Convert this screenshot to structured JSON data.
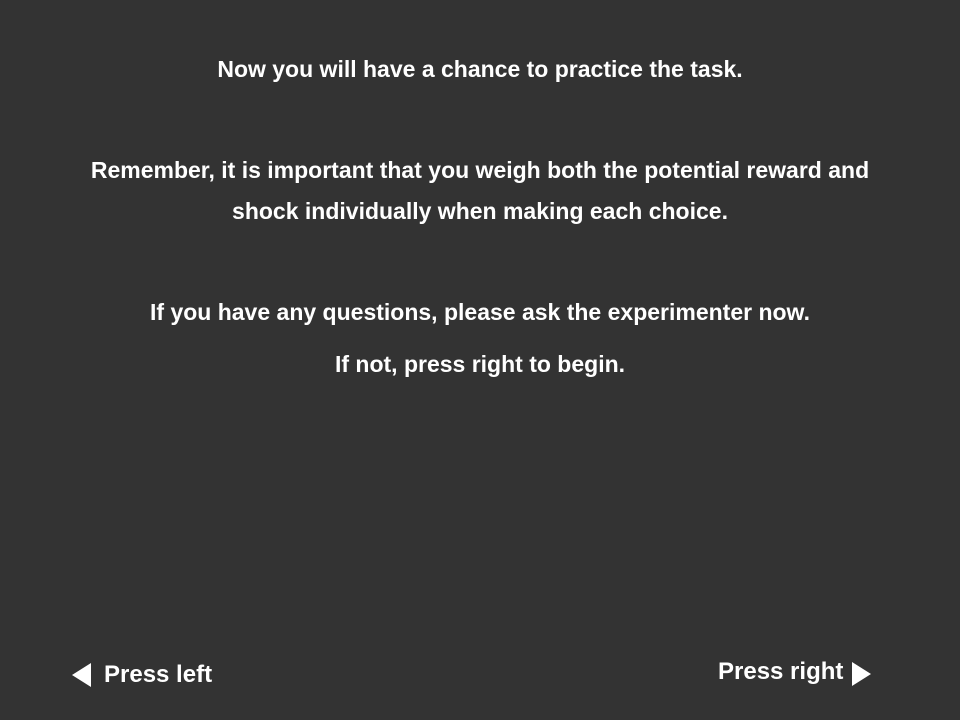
{
  "instructions": {
    "line1": "Now you will have a chance to practice the task.",
    "line2": "Remember, it is important that you weigh both the potential reward and",
    "line3": "shock individually when making each choice.",
    "line4": "If you have any questions, please ask the experimenter now.",
    "line5": "If not, press right to begin."
  },
  "navigation": {
    "left_label": "Press left",
    "left_icon": "triangle-left-icon",
    "right_label": "Press right",
    "right_icon": "triangle-right-icon"
  },
  "colors": {
    "background": "#333333",
    "text": "#ffffff"
  }
}
